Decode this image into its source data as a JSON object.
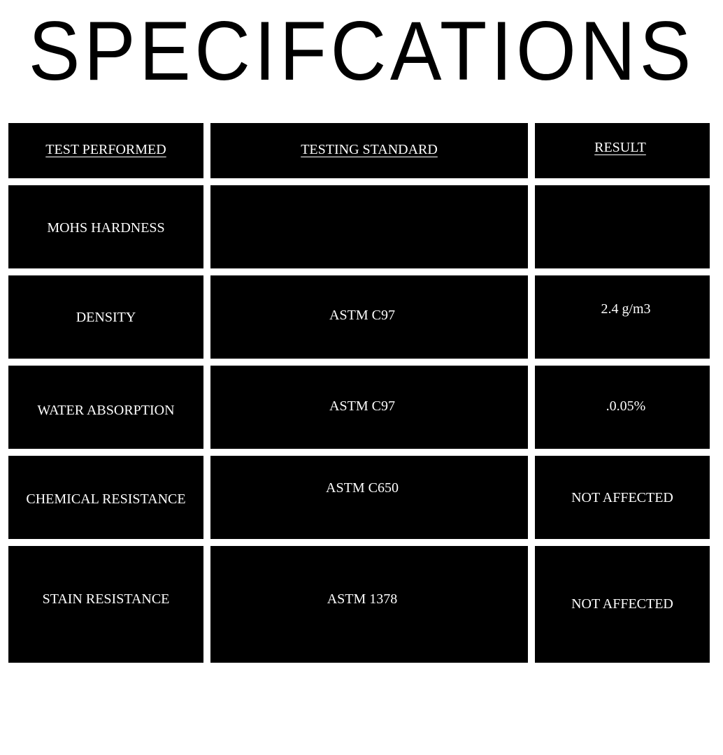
{
  "title": "SPECIFCATIONS",
  "headers": {
    "test_performed": "TEST PERFORMED",
    "testing_standard": "TESTING STANDARD",
    "result": "RESULT"
  },
  "rows": [
    {
      "test": "MOHS HARDNESS",
      "standard": "",
      "result": ""
    },
    {
      "test": "DENSITY",
      "standard": "ASTM C97",
      "result": "2.4 g/m3"
    },
    {
      "test": "WATER ABSORPTION",
      "standard": "ASTM C97",
      "result": ".0.05%"
    },
    {
      "test": "CHEMICAL RESISTANCE",
      "standard": "ASTM C650",
      "result": "NOT AFFECTED"
    },
    {
      "test": "STAIN RESISTANCE",
      "standard": "ASTM 1378",
      "result": "NOT AFFECTED"
    }
  ],
  "colors": {
    "cell_background": "#000000",
    "cell_text": "#ffffff",
    "page_background": "#ffffff",
    "title_text": "#000000"
  }
}
